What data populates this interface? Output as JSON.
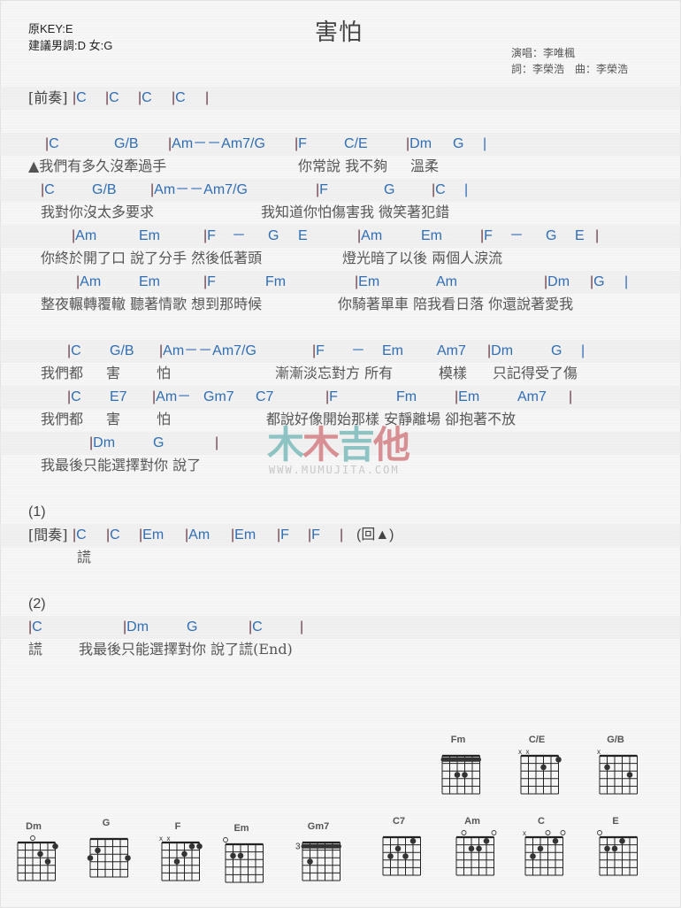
{
  "header": {
    "original_key": "原KEY:E",
    "suggested_key": "建議男調:D 女:G",
    "title": "害怕",
    "singer": "演唱：李唯楓",
    "credits": "詞：李榮浩　曲：李榮浩"
  },
  "intro": {
    "label": "[前奏]",
    "chords": [
      "C",
      "C",
      "C",
      "C"
    ]
  },
  "verse": [
    {
      "chords": [
        "|C",
        "G/B",
        "|Am－－Am7/G",
        "|F",
        "C/E",
        "|Dm",
        "G",
        "|"
      ],
      "lyrics": [
        "▲我們有多久沒牽過手",
        "你常說 我不夠",
        "溫柔"
      ]
    },
    {
      "chords": [
        "|C",
        "G/B",
        "|Am－－Am7/G",
        "|F",
        "G",
        "|C",
        "|"
      ],
      "lyrics": [
        "我對你沒太多要求",
        "我知道你怕傷害我 微笑著犯錯"
      ]
    },
    {
      "chords": [
        "|Am",
        "Em",
        "|F",
        "－",
        "G",
        "E",
        "|Am",
        "Em",
        "|F",
        "－",
        "G",
        "E",
        "|"
      ],
      "lyrics": [
        "你終於開了口 說了分手 然後低著頭",
        "燈光暗了以後 兩個人淚流"
      ]
    },
    {
      "chords": [
        "|Am",
        "Em",
        "|F",
        "Fm",
        "|Em",
        "Am",
        "|Dm",
        "|G",
        "|"
      ],
      "lyrics": [
        "整夜輾轉覆轍 聽著情歌 想到那時候",
        "你騎著單車 陪我看日落 你還說著愛我"
      ]
    }
  ],
  "chorus": [
    {
      "chords": [
        "|C",
        "G/B",
        "|Am－－Am7/G",
        "|F",
        "－",
        "Em",
        "Am7",
        "|Dm",
        "G",
        "|"
      ],
      "lyrics": [
        "我們都",
        "害",
        "怕",
        "漸漸淡忘對方 所有",
        "模樣",
        "只記得受了傷"
      ]
    },
    {
      "chords": [
        "|C",
        "E7",
        "|Am－",
        "Gm7",
        "C7",
        "|F",
        "Fm",
        "|Em",
        "Am7",
        "|"
      ],
      "lyrics": [
        "我們都",
        "害",
        "怕",
        "都說好像開始那樣 安靜離場 卻抱著不放"
      ]
    },
    {
      "chords": [
        "|Dm",
        "G",
        "|"
      ],
      "lyrics": [
        "我最後只能選擇對你 說了"
      ]
    }
  ],
  "ending1": {
    "marker": "(1)",
    "label": "[間奏]",
    "chords": [
      "|C",
      "|C",
      "|Em",
      "|Am",
      "|Em",
      "|F",
      "|F",
      "|"
    ],
    "repeat": "(回▲)",
    "lyric": "謊"
  },
  "ending2": {
    "marker": "(2)",
    "chords": [
      "|C",
      "|Dm",
      "G",
      "|C",
      "|"
    ],
    "lyrics": [
      "謊",
      "我最後只能選擇對你 說了謊(End)"
    ]
  },
  "watermark": {
    "chars": [
      "木",
      "木",
      "吉",
      "他"
    ],
    "colors": [
      "#8ec3c3",
      "#d88f93",
      "#8ec3c3",
      "#d88f93"
    ],
    "url": "WWW.MUMUJITA.COM"
  },
  "colors": {
    "chord": "#2f6db5",
    "bar": "#6b3a46",
    "lyric": "#555555"
  },
  "chord_charts": [
    {
      "name": "Fm",
      "barre_fret": 1,
      "dots": [
        [
          3,
          3
        ],
        [
          3,
          4
        ]
      ],
      "open": [],
      "muted": []
    },
    {
      "name": "C/E",
      "dots": [
        [
          1,
          1
        ],
        [
          2,
          3
        ]
      ],
      "open": [],
      "muted": [
        6,
        5
      ]
    },
    {
      "name": "G/B",
      "dots": [
        [
          2,
          5
        ],
        [
          3,
          2
        ]
      ],
      "open": [],
      "muted": [
        6
      ]
    },
    {
      "name": "Dm",
      "dots": [
        [
          1,
          1
        ],
        [
          2,
          3
        ],
        [
          3,
          2
        ]
      ],
      "open": [
        4
      ],
      "muted": []
    },
    {
      "name": "G",
      "dots": [
        [
          2,
          5
        ],
        [
          3,
          6
        ],
        [
          3,
          1
        ]
      ],
      "open": [],
      "muted": []
    },
    {
      "name": "F",
      "dots": [
        [
          1,
          2
        ],
        [
          1,
          1
        ],
        [
          2,
          3
        ],
        [
          3,
          4
        ]
      ],
      "open": [],
      "muted": [
        6,
        5
      ]
    },
    {
      "name": "Em",
      "dots": [
        [
          2,
          5
        ],
        [
          2,
          4
        ]
      ],
      "open": [
        6
      ],
      "muted": []
    },
    {
      "name": "Gm7",
      "start_fret": "3",
      "barre_fret": 1,
      "dots": [
        [
          3,
          5
        ]
      ],
      "open": [],
      "muted": []
    },
    {
      "name": "C7",
      "dots": [
        [
          1,
          2
        ],
        [
          2,
          4
        ],
        [
          3,
          5
        ],
        [
          3,
          3
        ]
      ],
      "open": [],
      "muted": []
    },
    {
      "name": "Am",
      "dots": [
        [
          1,
          2
        ],
        [
          2,
          4
        ],
        [
          2,
          3
        ]
      ],
      "open": [
        5,
        1
      ],
      "muted": []
    },
    {
      "name": "C",
      "dots": [
        [
          1,
          2
        ],
        [
          2,
          4
        ],
        [
          3,
          5
        ]
      ],
      "open": [
        3,
        1
      ],
      "muted": [
        6
      ]
    },
    {
      "name": "E",
      "dots": [
        [
          1,
          3
        ],
        [
          2,
          5
        ],
        [
          2,
          4
        ]
      ],
      "open": [
        6
      ],
      "muted": []
    }
  ]
}
